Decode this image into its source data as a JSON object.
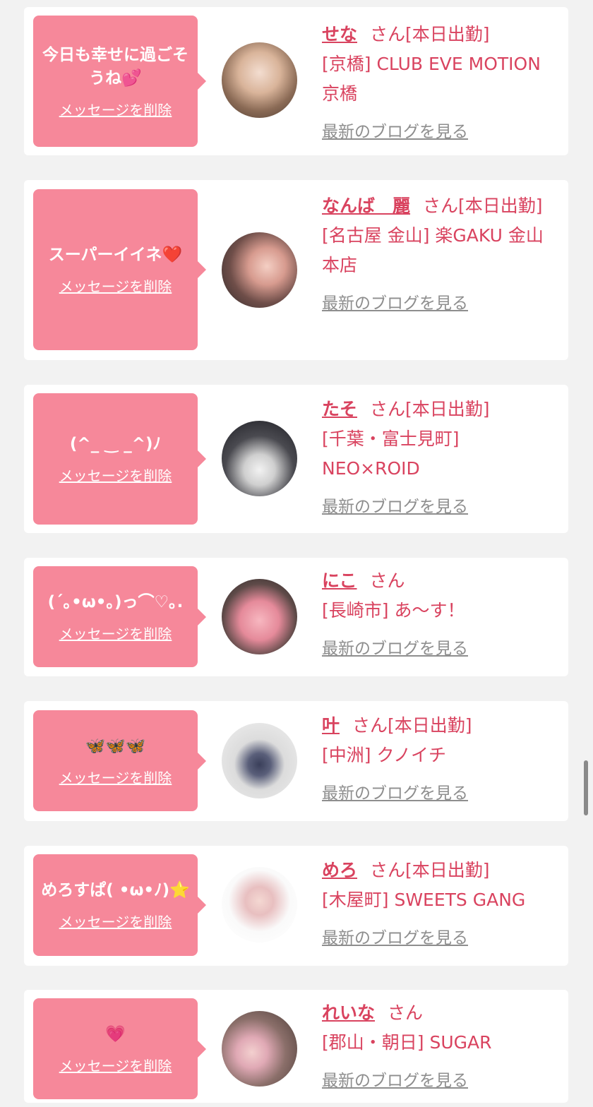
{
  "cards": [
    {
      "message": "今日も幸せに過ごそうね💕",
      "delete_label": "メッセージを削除",
      "name": "せな",
      "honorific": "さん",
      "status": "[本日出勤]",
      "location": "[京橋] CLUB EVE MOTION 京橋",
      "blog_label": "最新のブログを見る"
    },
    {
      "message": "スーパーイイネ❤️",
      "delete_label": "メッセージを削除",
      "name": "なんば　麗",
      "honorific": "さん",
      "status": "[本日出勤]",
      "location": "[名古屋 金山] 楽GAKU 金山本店",
      "blog_label": "最新のブログを見る"
    },
    {
      "message": "(^_ ‿ _^)ﾉ",
      "delete_label": "メッセージを削除",
      "name": "たそ",
      "honorific": "さん",
      "status": "[本日出勤]",
      "location": "[千葉・富士見町] NEO×ROID",
      "blog_label": "最新のブログを見る"
    },
    {
      "message": "(´｡•ω•｡)っ⌒♡｡.",
      "delete_label": "メッセージを削除",
      "name": "にこ",
      "honorific": "さん",
      "status": "",
      "location": "[長崎市] あ〜す！",
      "blog_label": "最新のブログを見る"
    },
    {
      "message": "🦋🦋🦋",
      "delete_label": "メッセージを削除",
      "name": "叶",
      "honorific": "さん",
      "status": "[本日出勤]",
      "location": "[中洲] クノイチ",
      "blog_label": "最新のブログを見る"
    },
    {
      "message": "めろすぱ( •ω•ﾉ)⭐",
      "delete_label": "メッセージを削除",
      "name": "めろ",
      "honorific": "さん",
      "status": "[本日出勤]",
      "location": "[木屋町] SWEETS GANG",
      "blog_label": "最新のブログを見る"
    },
    {
      "message": "💗",
      "delete_label": "メッセージを削除",
      "name": "れいな",
      "honorific": "さん",
      "status": "",
      "location": "[郡山・朝日] SUGAR",
      "blog_label": "最新のブログを見る"
    }
  ],
  "colors": {
    "accent_pink": "#f6889a",
    "name_red": "#d9435f",
    "link_gray": "#8e8e8e",
    "background": "#f2f2f2"
  }
}
